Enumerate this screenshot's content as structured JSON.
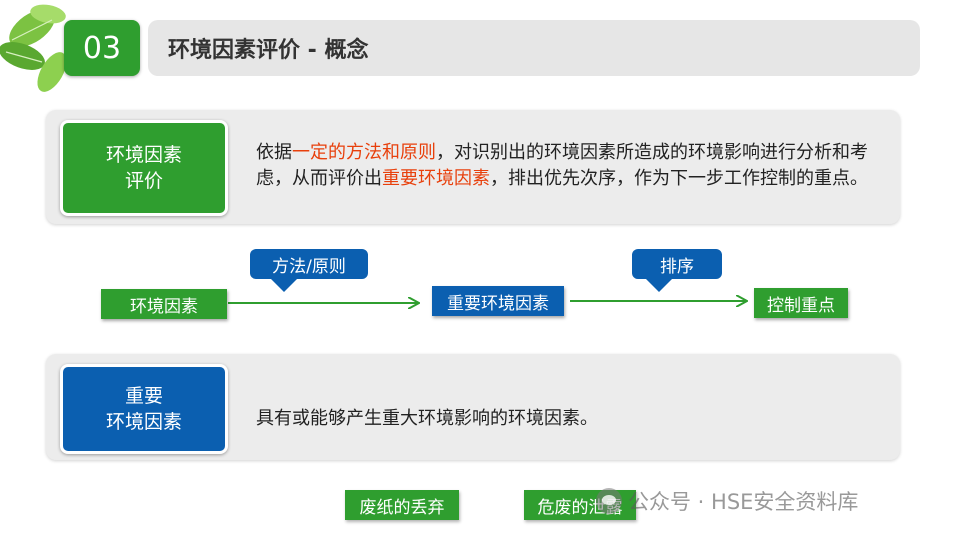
{
  "header": {
    "section_number": "03",
    "title": "环境因素评价 - 概念"
  },
  "definition": {
    "label_line1": "环境因素",
    "label_line2": "评价",
    "text_part1": "依据",
    "text_highlight1": "一定的方法和原则",
    "text_part2": "，对识别出的环境因素所造成的环境影响进行分析和考虑，从而评价出",
    "text_highlight2": "重要环境因素",
    "text_part3": "，排出优先次序，作为下一步工作控制的重点。"
  },
  "flow": {
    "node1": "环境因素",
    "node2": "重要环境因素",
    "node3": "控制重点",
    "callout1": "方法/原则",
    "callout2": "排序"
  },
  "important": {
    "label_line1": "重要",
    "label_line2": "环境因素",
    "text": "具有或能够产生重大环境影响的环境因素。"
  },
  "examples": [
    "废纸的丢弃",
    "危废的泄露"
  ],
  "watermark": {
    "text": "公众号 · HSE安全资料库",
    "icon": "wechat-icon"
  },
  "colors": {
    "green": "#2f9e2f",
    "blue": "#0b5fb0",
    "highlight_red": "#e8400c",
    "title_bar": "#e6e6e6"
  }
}
